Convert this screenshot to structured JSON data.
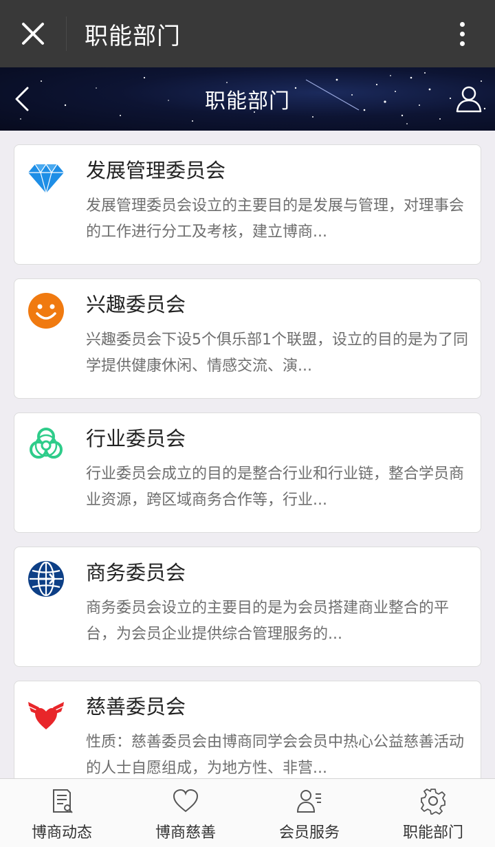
{
  "wechat_bar": {
    "title": "职能部门"
  },
  "header": {
    "title": "职能部门"
  },
  "committees": [
    {
      "icon": "diamond-icon",
      "title": "发展管理委员会",
      "desc": "发展管理委员会设立的主要目的是发展与管理，对理事会的工作进行分工及考核，建立博商..."
    },
    {
      "icon": "smiley-icon",
      "title": "兴趣委员会",
      "desc": "兴趣委员会下设5个俱乐部1个联盟，设立的目的是为了同学提供健康休闲、情感交流、演..."
    },
    {
      "icon": "biohazard-icon",
      "title": "行业委员会",
      "desc": "行业委员会成立的目的是整合行业和行业链，整合学员商业资源，跨区域商务合作等，行业..."
    },
    {
      "icon": "globe-icon",
      "title": "商务委员会",
      "desc": "商务委员会设立的主要目的是为会员搭建商业整合的平台，为会员企业提供综合管理服务的..."
    },
    {
      "icon": "winged-heart-icon",
      "title": "慈善委员会",
      "desc": "性质：慈善委员会由博商同学会会员中热心公益慈善活动的人士自愿组成，为地方性、非营..."
    }
  ],
  "tabs": [
    {
      "label": "博商动态",
      "icon": "news-icon"
    },
    {
      "label": "博商慈善",
      "icon": "heart-icon"
    },
    {
      "label": "会员服务",
      "icon": "member-icon"
    },
    {
      "label": "职能部门",
      "icon": "gear-icon"
    }
  ],
  "colors": {
    "diamond": "#1e8ee6",
    "smiley": "#f07a10",
    "biohazard": "#2ecc8a",
    "globe": "#0d3f86",
    "heart": "#e8262a"
  }
}
